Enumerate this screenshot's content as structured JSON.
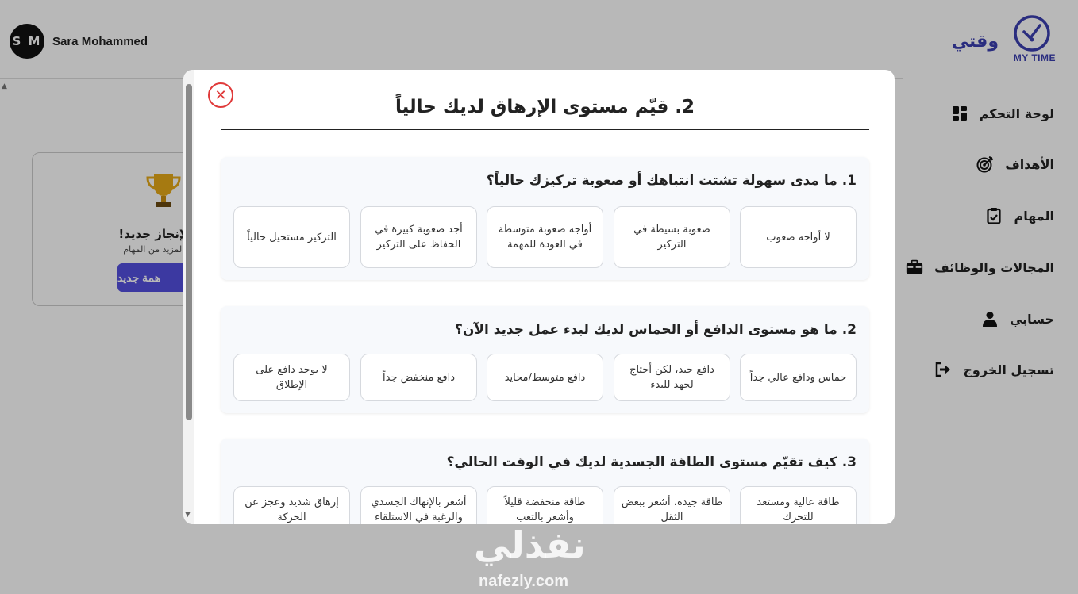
{
  "user": {
    "initials": "S M",
    "name": "Sara Mohammed"
  },
  "logo": {
    "ar": "وقتي",
    "en": "MY TIME"
  },
  "sidebar": {
    "items": [
      {
        "label": "لوحة التحكم",
        "icon": "dashboard-icon"
      },
      {
        "label": "الأهداف",
        "icon": "target-icon"
      },
      {
        "label": "المهام",
        "icon": "clipboard-icon"
      },
      {
        "label": "المجالات والوظائف",
        "icon": "briefcase-icon"
      },
      {
        "label": "حسابي",
        "icon": "user-icon"
      },
      {
        "label": "تسجيل الخروج",
        "icon": "logout-icon"
      }
    ]
  },
  "achievement": {
    "title": "د لإنجاز جديد!",
    "subtitle": "افة المزيد من المهام",
    "button": "همة جديد"
  },
  "modal": {
    "title": "2. قيّم مستوى الإرهاق لديك حالياً",
    "questions": [
      {
        "text": "1. ما مدى سهولة تشتت انتباهك أو صعوبة تركيزك حالياً؟",
        "options": [
          "لا أواجه صعوب",
          "صعوبة بسيطة في التركيز",
          "أواجه صعوبة متوسطة في العودة للمهمة",
          "أجد صعوبة كبيرة في الحفاظ على التركيز",
          "التركيز مستحيل حالياً"
        ]
      },
      {
        "text": "2. ما هو مستوى الدافع أو الحماس لديك لبدء عمل جديد الآن؟",
        "options": [
          "حماس ودافع عالي جداً",
          "دافع جيد، لكن أحتاج لجهد للبدء",
          "دافع متوسط/محايد",
          "دافع منخفض جداً",
          "لا يوجد دافع على الإطلاق"
        ]
      },
      {
        "text": "3. كيف تقيّم مستوى الطاقة الجسدية لديك في الوقت الحالي؟",
        "options": [
          "طاقة عالية ومستعد للتحرك",
          "طاقة جيدة، أشعر ببعض الثقل",
          "طاقة منخفضة قليلاً وأشعر بالتعب",
          "أشعر بالإنهاك الجسدي والرغبة في الاستلقاء",
          "إرهاق شديد وعجز عن الحركة"
        ]
      }
    ]
  },
  "watermark": {
    "ar": "نفذلي",
    "en": "nafezly.com"
  },
  "colors": {
    "accent": "#5450e0",
    "brand": "#3b3fb0",
    "close": "#e03a3a"
  }
}
